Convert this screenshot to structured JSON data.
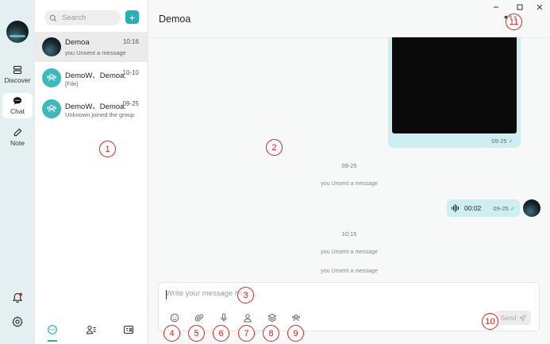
{
  "sidebar": {
    "items": [
      {
        "label": "Discover",
        "icon": "discover-icon"
      },
      {
        "label": "Chat",
        "icon": "chat-icon"
      },
      {
        "label": "Note",
        "icon": "note-icon"
      }
    ],
    "active": "Chat"
  },
  "search": {
    "placeholder": "Search"
  },
  "conversations": [
    {
      "name": "Demoa",
      "time": "10:16",
      "message": "you Unsent a message",
      "avatar": "photo"
    },
    {
      "name": "DemoW、Demoa...",
      "time": "10-10",
      "message": "[File]",
      "avatar": "group"
    },
    {
      "name": "DemoW、Demoa...",
      "time": "09-25",
      "message": "Unknown joined the group",
      "avatar": "group"
    }
  ],
  "chat": {
    "title": "Demoa",
    "image_message_time": "09-25",
    "date_divider_1": "09-25",
    "system_1": "you Unsent a message",
    "voice": {
      "duration": "00:02",
      "time": "09-25"
    },
    "date_divider_2": "10:15",
    "system_2": "you Unsent a message",
    "system_3": "you Unsent a message"
  },
  "composer": {
    "placeholder": "Write your message here...",
    "send_label": "Send"
  },
  "annotations": [
    "1",
    "2",
    "3",
    "4",
    "5",
    "6",
    "7",
    "8",
    "9",
    "10",
    "11"
  ],
  "colors": {
    "accent": "#21b2b9",
    "bubble": "#cdeff1",
    "annotation": "#e0211b",
    "rail": "#e3eff0"
  }
}
